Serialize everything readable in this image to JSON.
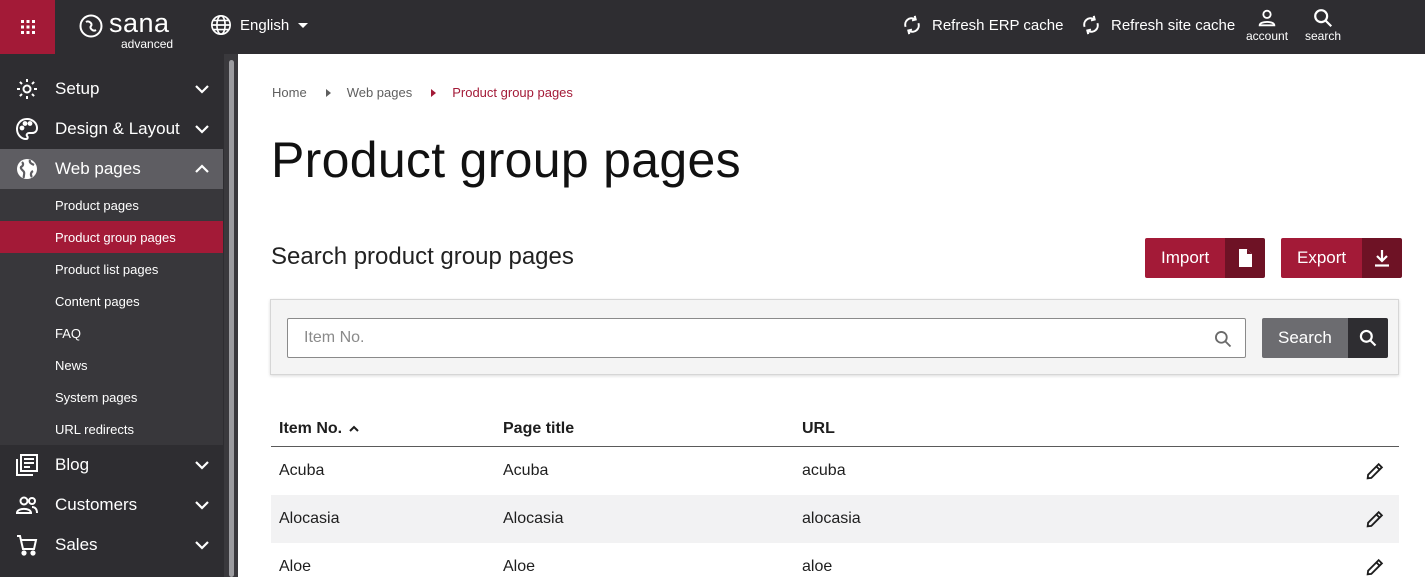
{
  "header": {
    "logo_name": "sana",
    "logo_sub": "advanced",
    "language": "English",
    "refresh_erp": "Refresh ERP cache",
    "refresh_site": "Refresh site cache",
    "account": "account",
    "search": "search"
  },
  "sidebar": {
    "items": [
      {
        "label": "Setup",
        "icon": "gear-icon"
      },
      {
        "label": "Design & Layout",
        "icon": "palette-icon"
      },
      {
        "label": "Web pages",
        "icon": "globe-icon"
      },
      {
        "label": "Blog",
        "icon": "blog-icon"
      },
      {
        "label": "Customers",
        "icon": "people-icon"
      },
      {
        "label": "Sales",
        "icon": "cart-icon"
      }
    ],
    "sub_items": [
      "Product pages",
      "Product group pages",
      "Product list pages",
      "Content pages",
      "FAQ",
      "News",
      "System pages",
      "URL redirects"
    ],
    "active_sub": "Product group pages"
  },
  "breadcrumb": [
    "Home",
    "Web pages",
    "Product group pages"
  ],
  "page_title": "Product group pages",
  "section_title": "Search product group pages",
  "buttons": {
    "import": "Import",
    "export": "Export",
    "search": "Search"
  },
  "search": {
    "placeholder": "Item No.",
    "value": ""
  },
  "table": {
    "columns": [
      "Item No.",
      "Page title",
      "URL"
    ],
    "sorted_column": "Item No.",
    "sort_direction": "ascending",
    "rows": [
      {
        "item_no": "Acuba",
        "page_title": "Acuba",
        "url": "acuba"
      },
      {
        "item_no": "Alocasia",
        "page_title": "Alocasia",
        "url": "alocasia"
      },
      {
        "item_no": "Aloe",
        "page_title": "Aloe",
        "url": "aloe"
      }
    ]
  },
  "colors": {
    "brand": "#a31a37",
    "brand_dark": "#6e1225",
    "nav_bg": "#2e2d31"
  }
}
